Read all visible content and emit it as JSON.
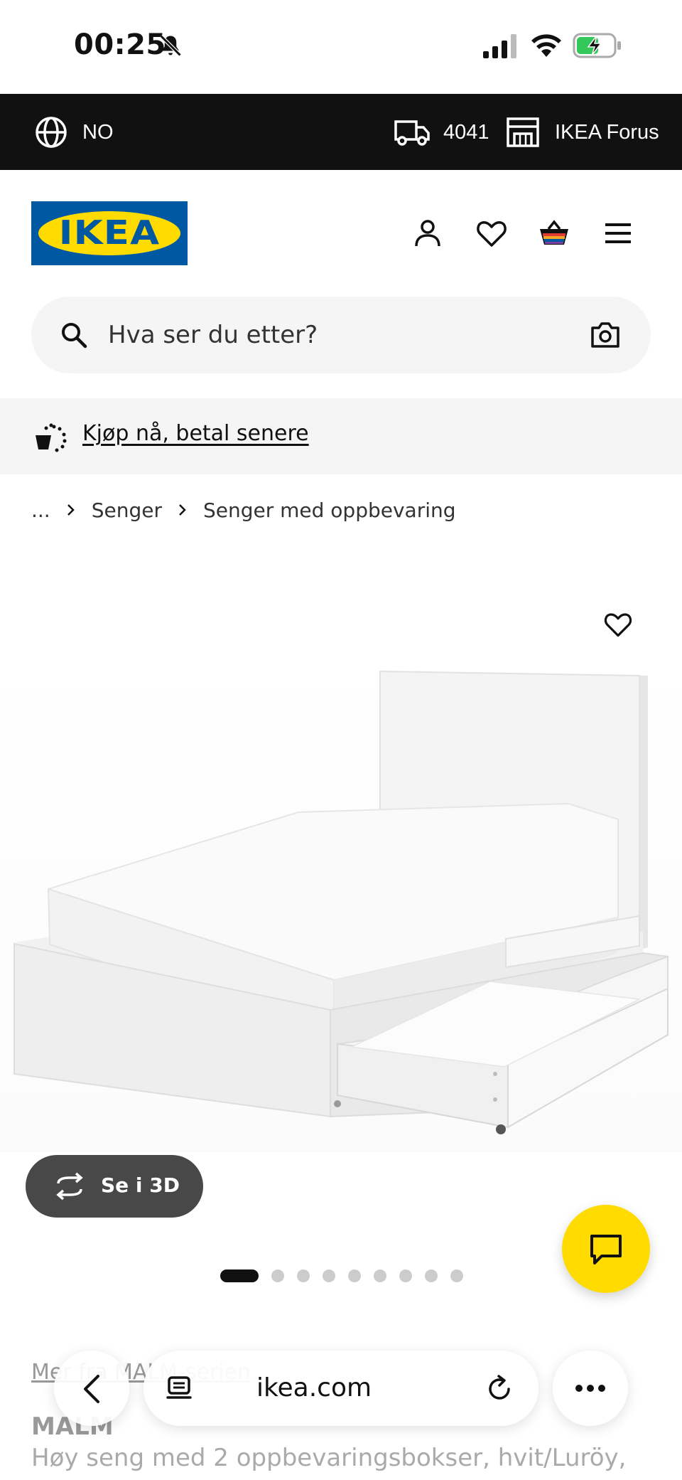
{
  "status_bar": {
    "time": "00:25"
  },
  "top_bar": {
    "country": "NO",
    "postal_code": "4041",
    "store": "IKEA Forus"
  },
  "header": {
    "logo_text": "IKEA"
  },
  "search": {
    "placeholder": "Hva ser du etter?"
  },
  "promo": {
    "label": "Kjøp nå, betal senere"
  },
  "breadcrumb": {
    "ellipsis": "...",
    "items": [
      "Senger",
      "Senger med oppbevaring"
    ]
  },
  "product": {
    "view_3d_label": "Se i 3D",
    "gallery": {
      "total": 9,
      "active_index": 0
    },
    "series_links": "Mer fra MALM-serien",
    "name": "MALM",
    "description": "Høy seng med 2 oppbevaringsbokser, hvit/Luröy,"
  },
  "browser": {
    "url": "ikea.com"
  },
  "colors": {
    "brand_blue": "#0058A3",
    "brand_yellow": "#FFDB00",
    "top_bar": "#111111"
  }
}
